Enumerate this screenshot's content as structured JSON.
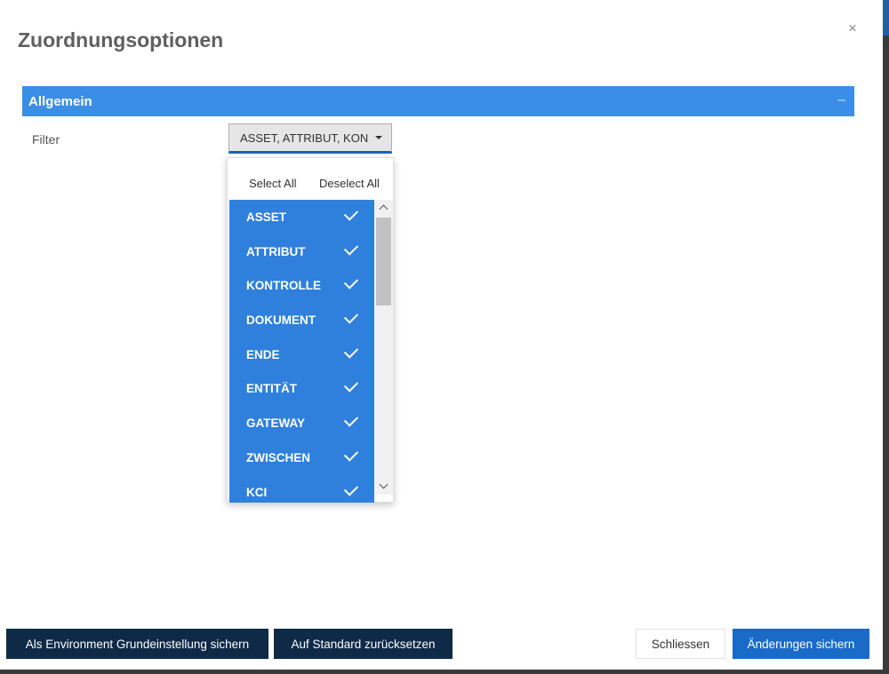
{
  "dialog": {
    "title": "Zuordnungsoptionen",
    "close_symbol": "×"
  },
  "section": {
    "title": "Allgemein",
    "collapse_symbol": "–"
  },
  "filter": {
    "label": "Filter",
    "selected_text": "ASSET, ATTRIBUT, KON",
    "select_all_label": "Select All",
    "deselect_all_label": "Deselect All",
    "options": [
      {
        "label": "ASSET",
        "checked": true
      },
      {
        "label": "ATTRIBUT",
        "checked": true
      },
      {
        "label": "KONTROLLE",
        "checked": true
      },
      {
        "label": "DOKUMENT",
        "checked": true
      },
      {
        "label": "ENDE",
        "checked": true
      },
      {
        "label": "ENTITÄT",
        "checked": true
      },
      {
        "label": "GATEWAY",
        "checked": true
      },
      {
        "label": "ZWISCHEN",
        "checked": true
      },
      {
        "label": "KCI",
        "checked": true
      }
    ]
  },
  "footer": {
    "env_default_label": "Als Environment Grundeinstellung sichern",
    "reset_label": "Auf Standard zurücksetzen",
    "close_label": "Schliessen",
    "save_label": "Änderungen sichern"
  },
  "colors": {
    "section_header": "#3b8ee6",
    "option_selected": "#2f80dd",
    "dark_button": "#0f2a47",
    "primary_button": "#1a6bc8"
  }
}
